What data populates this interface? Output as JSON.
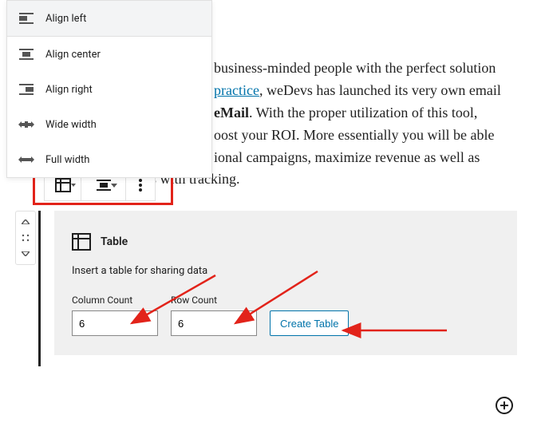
{
  "alignMenu": {
    "items": [
      {
        "label": "Align left"
      },
      {
        "label": "Align center"
      },
      {
        "label": "Align right"
      },
      {
        "label": "Wide width"
      },
      {
        "label": "Full width"
      }
    ]
  },
  "paragraph": {
    "pre1": "business-minded people with the perfect solution ",
    "link": "practice",
    "aft1": ", weDevs has launched its very own email ",
    "bold": "eMail",
    "aft2": ". With the proper utilization of this tool, ",
    "l4": "oost your ROI. More essentially you will be able ",
    "l5": "ional campaigns, maximize revenue as well as ",
    "l6": "rts with tracking."
  },
  "tableBlock": {
    "title": "Table",
    "description": "Insert a table for sharing data",
    "columnLabel": "Column Count",
    "rowLabel": "Row Count",
    "columnValue": "6",
    "rowValue": "6",
    "createLabel": "Create Table"
  },
  "colors": {
    "highlight": "#e2231a",
    "link": "#0073aa"
  }
}
